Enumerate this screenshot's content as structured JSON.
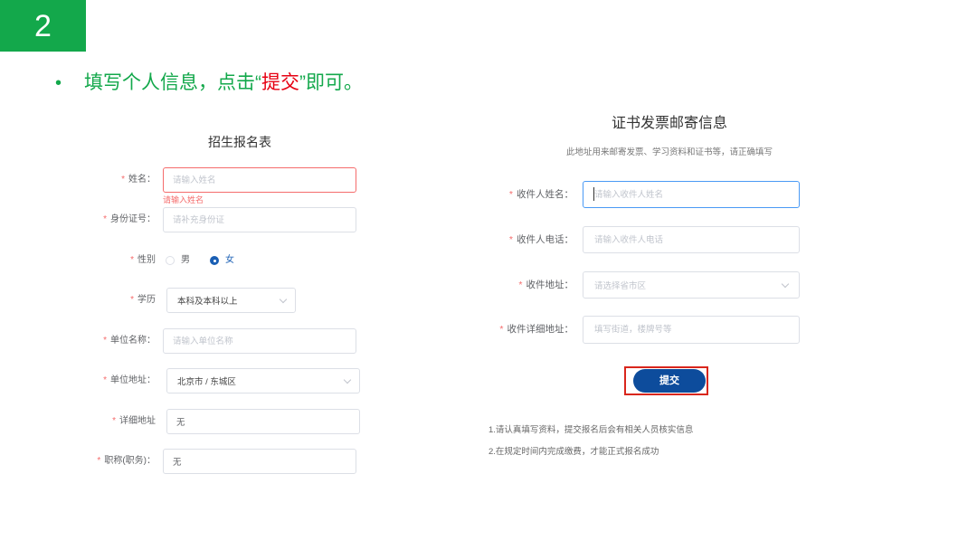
{
  "step": {
    "number": "2"
  },
  "instruction": {
    "bullet": "•",
    "text_before": "填写个人信息，点击“",
    "highlight": "提交",
    "text_after": "”即可。"
  },
  "enroll_form": {
    "title": "招生报名表",
    "required_mark": "*",
    "name": {
      "label": "姓名：",
      "placeholder": "请输入姓名",
      "value": "",
      "error": "请输入姓名"
    },
    "id_number": {
      "label": "身份证号：",
      "placeholder": "请补充身份证",
      "value": ""
    },
    "gender": {
      "label": "性别",
      "options": [
        {
          "label": "男",
          "checked": false
        },
        {
          "label": "女",
          "checked": true
        }
      ]
    },
    "education": {
      "label": "学历",
      "value": "本科及本科以上"
    },
    "company_name": {
      "label": "单位名称：",
      "placeholder": "请输入单位名称",
      "value": ""
    },
    "company_address": {
      "label": "单位地址：",
      "value": "北京市 / 东城区"
    },
    "detail_address": {
      "label": "详细地址",
      "value": "无"
    },
    "job_title": {
      "label": "职称(职务)：",
      "value": "无"
    }
  },
  "mail_form": {
    "title": "证书发票邮寄信息",
    "subtitle": "此地址用来邮寄发票、学习资料和证书等，请正确填写",
    "required_mark": "*",
    "recipient_name": {
      "label": "收件人姓名：",
      "placeholder": "请输入收件人姓名",
      "value": ""
    },
    "recipient_phone": {
      "label": "收件人电话：",
      "placeholder": "请输入收件人电话",
      "value": ""
    },
    "recipient_region": {
      "label": "收件地址：",
      "placeholder": "请选择省市区"
    },
    "recipient_detail": {
      "label": "收件详细地址：",
      "placeholder": "填写街道，楼牌号等",
      "value": ""
    },
    "submit_label": "提交",
    "notes": [
      "1.请认真填写资料，提交报名后会有相关人员核实信息",
      "2.在规定时间内完成缴费，才能正式报名成功"
    ]
  },
  "theme": {
    "green": "#13a84b",
    "red": "#e60012",
    "navy": "#0d4c9c",
    "focus": "#4a9af5",
    "error": "#f56c6c",
    "radio": "#1a5fb4",
    "outline": "#d9261c"
  }
}
